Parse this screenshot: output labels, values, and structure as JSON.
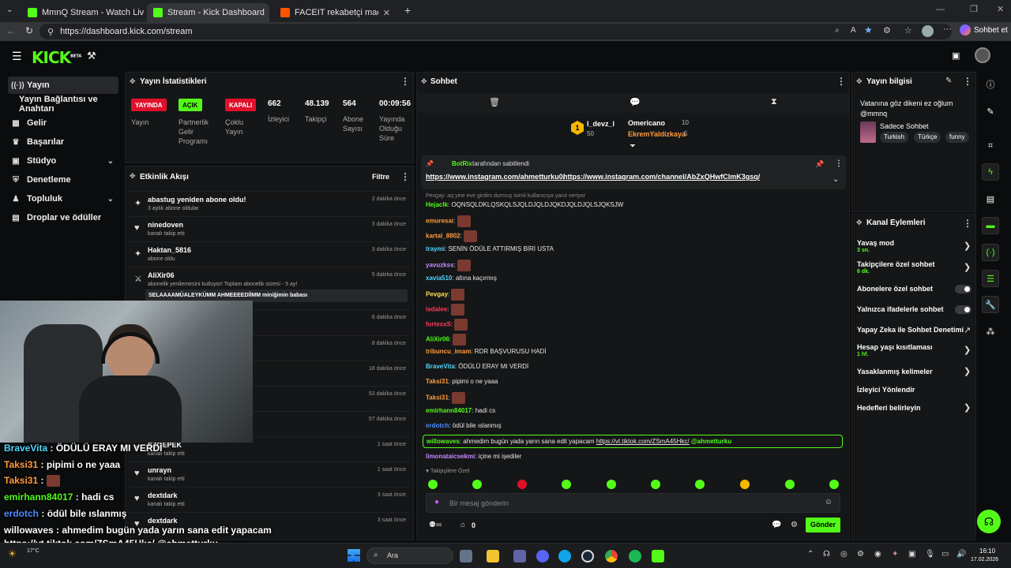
{
  "browser": {
    "tabs": [
      {
        "title": "MmnQ Stream - Watch Live on Kick"
      },
      {
        "title": "Stream - Kick Dashboard"
      },
      {
        "title": "FACEIT rekabetçi maç - FACEIT.com"
      }
    ],
    "url": "https://dashboard.kick.com/stream",
    "sidebar_chat_label": "Sohbet et"
  },
  "header": {
    "logo": "KICK",
    "beta": "BETA"
  },
  "sidenav": {
    "items": [
      {
        "label": "Yayın"
      },
      {
        "label": "Yayın Bağlantısı ve Anahtarı"
      },
      {
        "label": "Gelir"
      },
      {
        "label": "Başarılar"
      },
      {
        "label": "Stüdyo"
      },
      {
        "label": "Denetleme"
      },
      {
        "label": "Topluluk"
      },
      {
        "label": "Droplar ve ödüller"
      }
    ]
  },
  "stats": {
    "title": "Yayın İstatistikleri",
    "badges": [
      {
        "label": "YAYINDA",
        "caption": "Yayın",
        "color": "#e0102a"
      },
      {
        "label": "AÇIK",
        "caption": "Partnerlik Gelir Programı",
        "color": "#53fc18"
      },
      {
        "label": "KAPALI",
        "caption": "Çoklu Yayın",
        "color": "#e0102a"
      }
    ],
    "numbers": [
      {
        "value": "662",
        "label": "İzleyici"
      },
      {
        "value": "48.139",
        "label": "Takipçi"
      },
      {
        "value": "564",
        "label": "Abone Sayısı"
      },
      {
        "value": "00:09:56",
        "label": "Yayında Olduğu Süre"
      }
    ]
  },
  "activity": {
    "title": "Etkinlik Akışı",
    "filter": "Filtre",
    "items": [
      {
        "name": "abastug yeniden abone oldu!",
        "sub": "3 aylık abone oldular",
        "time": "2 dakika önce",
        "icon": "star"
      },
      {
        "name": "ninedoven",
        "sub": "kanalı takip etti",
        "time": "3 dakika önce",
        "icon": "heart"
      },
      {
        "name": "Haktan_5816",
        "sub": "abone oldu",
        "time": "3 dakika önce",
        "icon": "star"
      },
      {
        "name": "AliXir06",
        "sub": "abonelik yenilemesini kutluyor! Toplam abonelik süresi - 5 ay!",
        "time": "5 dakika önce",
        "icon": "sword"
      },
      {
        "name": "",
        "sub": "",
        "time": "6 dakika önce",
        "icon": "heart"
      },
      {
        "name": "",
        "sub": "",
        "time": "8 dakika önce",
        "icon": "heart"
      },
      {
        "name": "",
        "sub": "",
        "time": "18 dakika önce",
        "icon": "heart"
      },
      {
        "name": "",
        "sub": "",
        "time": "53 dakika önce",
        "icon": "heart"
      },
      {
        "name": "",
        "sub": "",
        "time": "57 dakika önce",
        "icon": "heart"
      },
      {
        "name": "SZGEPEK",
        "sub": "kanalı takip etti",
        "time": "1 saat önce",
        "icon": "heart"
      },
      {
        "name": "unrayn",
        "sub": "kanalı takip etti",
        "time": "1 saat önce",
        "icon": "heart"
      },
      {
        "name": "dextdark",
        "sub": "kanalı takip etti",
        "time": "3 saat önce",
        "icon": "heart"
      },
      {
        "name": "dextdark",
        "sub": "",
        "time": "3 saat önce",
        "icon": "heart"
      }
    ],
    "highlight": "SELAAAAMÜALEYKÜMM AHMEEEEDİİMM miniğimin babası"
  },
  "chat": {
    "title": "Sohbet",
    "leaderboard": [
      {
        "rank": "1",
        "name": "l_devz_l",
        "count": "50"
      },
      {
        "name": "Omericano",
        "count": "10"
      },
      {
        "name": "EkremYaldizkaya",
        "count": "5"
      }
    ],
    "pinned": {
      "author": "BotRix",
      "by": "tarafından sabitlendi",
      "link1": "https://www.instagram.com/ahmetturku0/",
      "link2": "https://www.instagram.com/channel/AbZxQHwfClmK3gsq/"
    },
    "reply_hint": "Pevgay: aq yine eve girdim durmuş isimil kullanıcıya yanıt veriyor",
    "messages": [
      {
        "user": "Hejaclk",
        "text": "OQNSQLDKLQSKQLSJQLDJQLDJQKDJQLDJQLSJQKSJW",
        "color": "#53fc18",
        "emote": false
      },
      {
        "user": "emuresai",
        "text": "",
        "color": "#ff9b3d",
        "emote": true
      },
      {
        "user": "kartal_8802",
        "text": "",
        "color": "#ff9b3d",
        "emote": true
      },
      {
        "user": "traymi",
        "text": "SENİN ÖDÜLE ATTIRMIŞ BİRİ USTA",
        "color": "#4fd6ff",
        "emote": false
      },
      {
        "user": "yavuzkss",
        "text": "",
        "color": "#c48bff",
        "emote": true
      },
      {
        "user": "xavia510",
        "text": "altına kaçırmış",
        "color": "#4fd6ff",
        "emote": false
      },
      {
        "user": "Pevgay",
        "text": "",
        "color": "#ffe14d",
        "emote": true
      },
      {
        "user": "isdalee",
        "text": "",
        "color": "#ff3b5c",
        "emote": true
      },
      {
        "user": "fortexxS",
        "text": "",
        "color": "#ff3b5c",
        "emote": true
      },
      {
        "user": "AliXir06",
        "text": "",
        "color": "#53fc18",
        "emote": true
      },
      {
        "user": "tribuncu_imam",
        "text": "RDR BAŞVURUSU HADİ",
        "color": "#ff9b3d",
        "emote": false
      },
      {
        "user": "BraveVita",
        "text": "ÖDÜLÜ ERAY MI VERDİ",
        "color": "#4fd6ff",
        "emote": false
      },
      {
        "user": "Taksi31",
        "text": "pipimi o ne yaaa",
        "color": "#ff9b3d",
        "emote": false
      },
      {
        "user": "Taksi31",
        "text": "",
        "color": "#ff9b3d",
        "emote": true
      },
      {
        "user": "emirhann84017",
        "text": "hadi cs",
        "color": "#53fc18",
        "emote": false
      },
      {
        "user": "erdotch",
        "text": "ödül bile ıslanmış",
        "color": "#4f8bff",
        "emote": false
      },
      {
        "user": "willowaves",
        "text": "ahmedim bugün yada yarın sana edit yapacam",
        "color": "#53fc18",
        "emote": false,
        "link": "https://vt.tiktok.com/ZSmA45Hkc/",
        "mention": "@ahmetturku"
      },
      {
        "user": "limonataicsekmi",
        "text": "içine mi işediler",
        "color": "#c48bff",
        "emote": false
      }
    ],
    "followers_only": "Takipçilere Özel",
    "input_placeholder": "Bir mesaj gönderin",
    "viewer_count": "0",
    "send": "Gönder"
  },
  "stream_info": {
    "title": "Yayın bilgisi",
    "stream_title": "Vatanına göz dikeni ez oğlum @mmnq",
    "category": "Sadece Sohbet",
    "tags": [
      "Turkish",
      "Türkçe",
      "funny"
    ]
  },
  "channel_actions": {
    "title": "Kanal Eylemleri",
    "items": [
      {
        "label": "Yavaş mod",
        "sub": "3 sn.",
        "control": "chevron"
      },
      {
        "label": "Takipçilere özel sohbet",
        "sub": "6 dk.",
        "control": "chevron"
      },
      {
        "label": "Abonelere özel sohbet",
        "sub": "",
        "control": "toggle"
      },
      {
        "label": "Yalnızca ifadelerle sohbet",
        "sub": "",
        "control": "toggle"
      },
      {
        "label": "Yapay Zeka ile Sohbet Denetimi",
        "sub": "",
        "control": "chart"
      },
      {
        "label": "Hesap yaşı kısıtlaması",
        "sub": "1 hf.",
        "control": "chevron"
      },
      {
        "label": "Yasaklanmış kelimeler",
        "sub": "",
        "control": "chevron"
      },
      {
        "label": "İzleyici Yönlendir",
        "sub": "",
        "control": "none"
      },
      {
        "label": "Hedefleri belirleyin",
        "sub": "",
        "control": "chevron"
      }
    ]
  },
  "overlay_chat": [
    {
      "user": "BraveVita",
      "text": "ÖDÜLÜ ERAY MI VERDİ",
      "color": "#4fd6ff"
    },
    {
      "user": "Taksi31",
      "text": "pipimi o ne yaaa",
      "color": "#ff9b3d"
    },
    {
      "user": "Taksi31",
      "text": "",
      "color": "#ff9b3d"
    },
    {
      "user": "emirhann84017",
      "text": "hadi cs",
      "color": "#53fc18"
    },
    {
      "user": "erdotch",
      "text": "ödül bile ıslanmış",
      "color": "#4f8bff"
    },
    {
      "user": "willowaves",
      "text": "ahmedim bugün yada yarın sana edit yapacam",
      "color": "#ffffff"
    },
    {
      "user": "",
      "text": "https://vt.tiktok.com/ZSmA45Hkc/ @ahmetturku",
      "color": "#ffffff"
    },
    {
      "user": "limonataicsekmi",
      "text": "içine mi işediler",
      "color": "#ffffff"
    }
  ],
  "taskbar": {
    "search": "Ara",
    "weather": "17°C",
    "time": "16:10",
    "date": "17.02.2026"
  }
}
